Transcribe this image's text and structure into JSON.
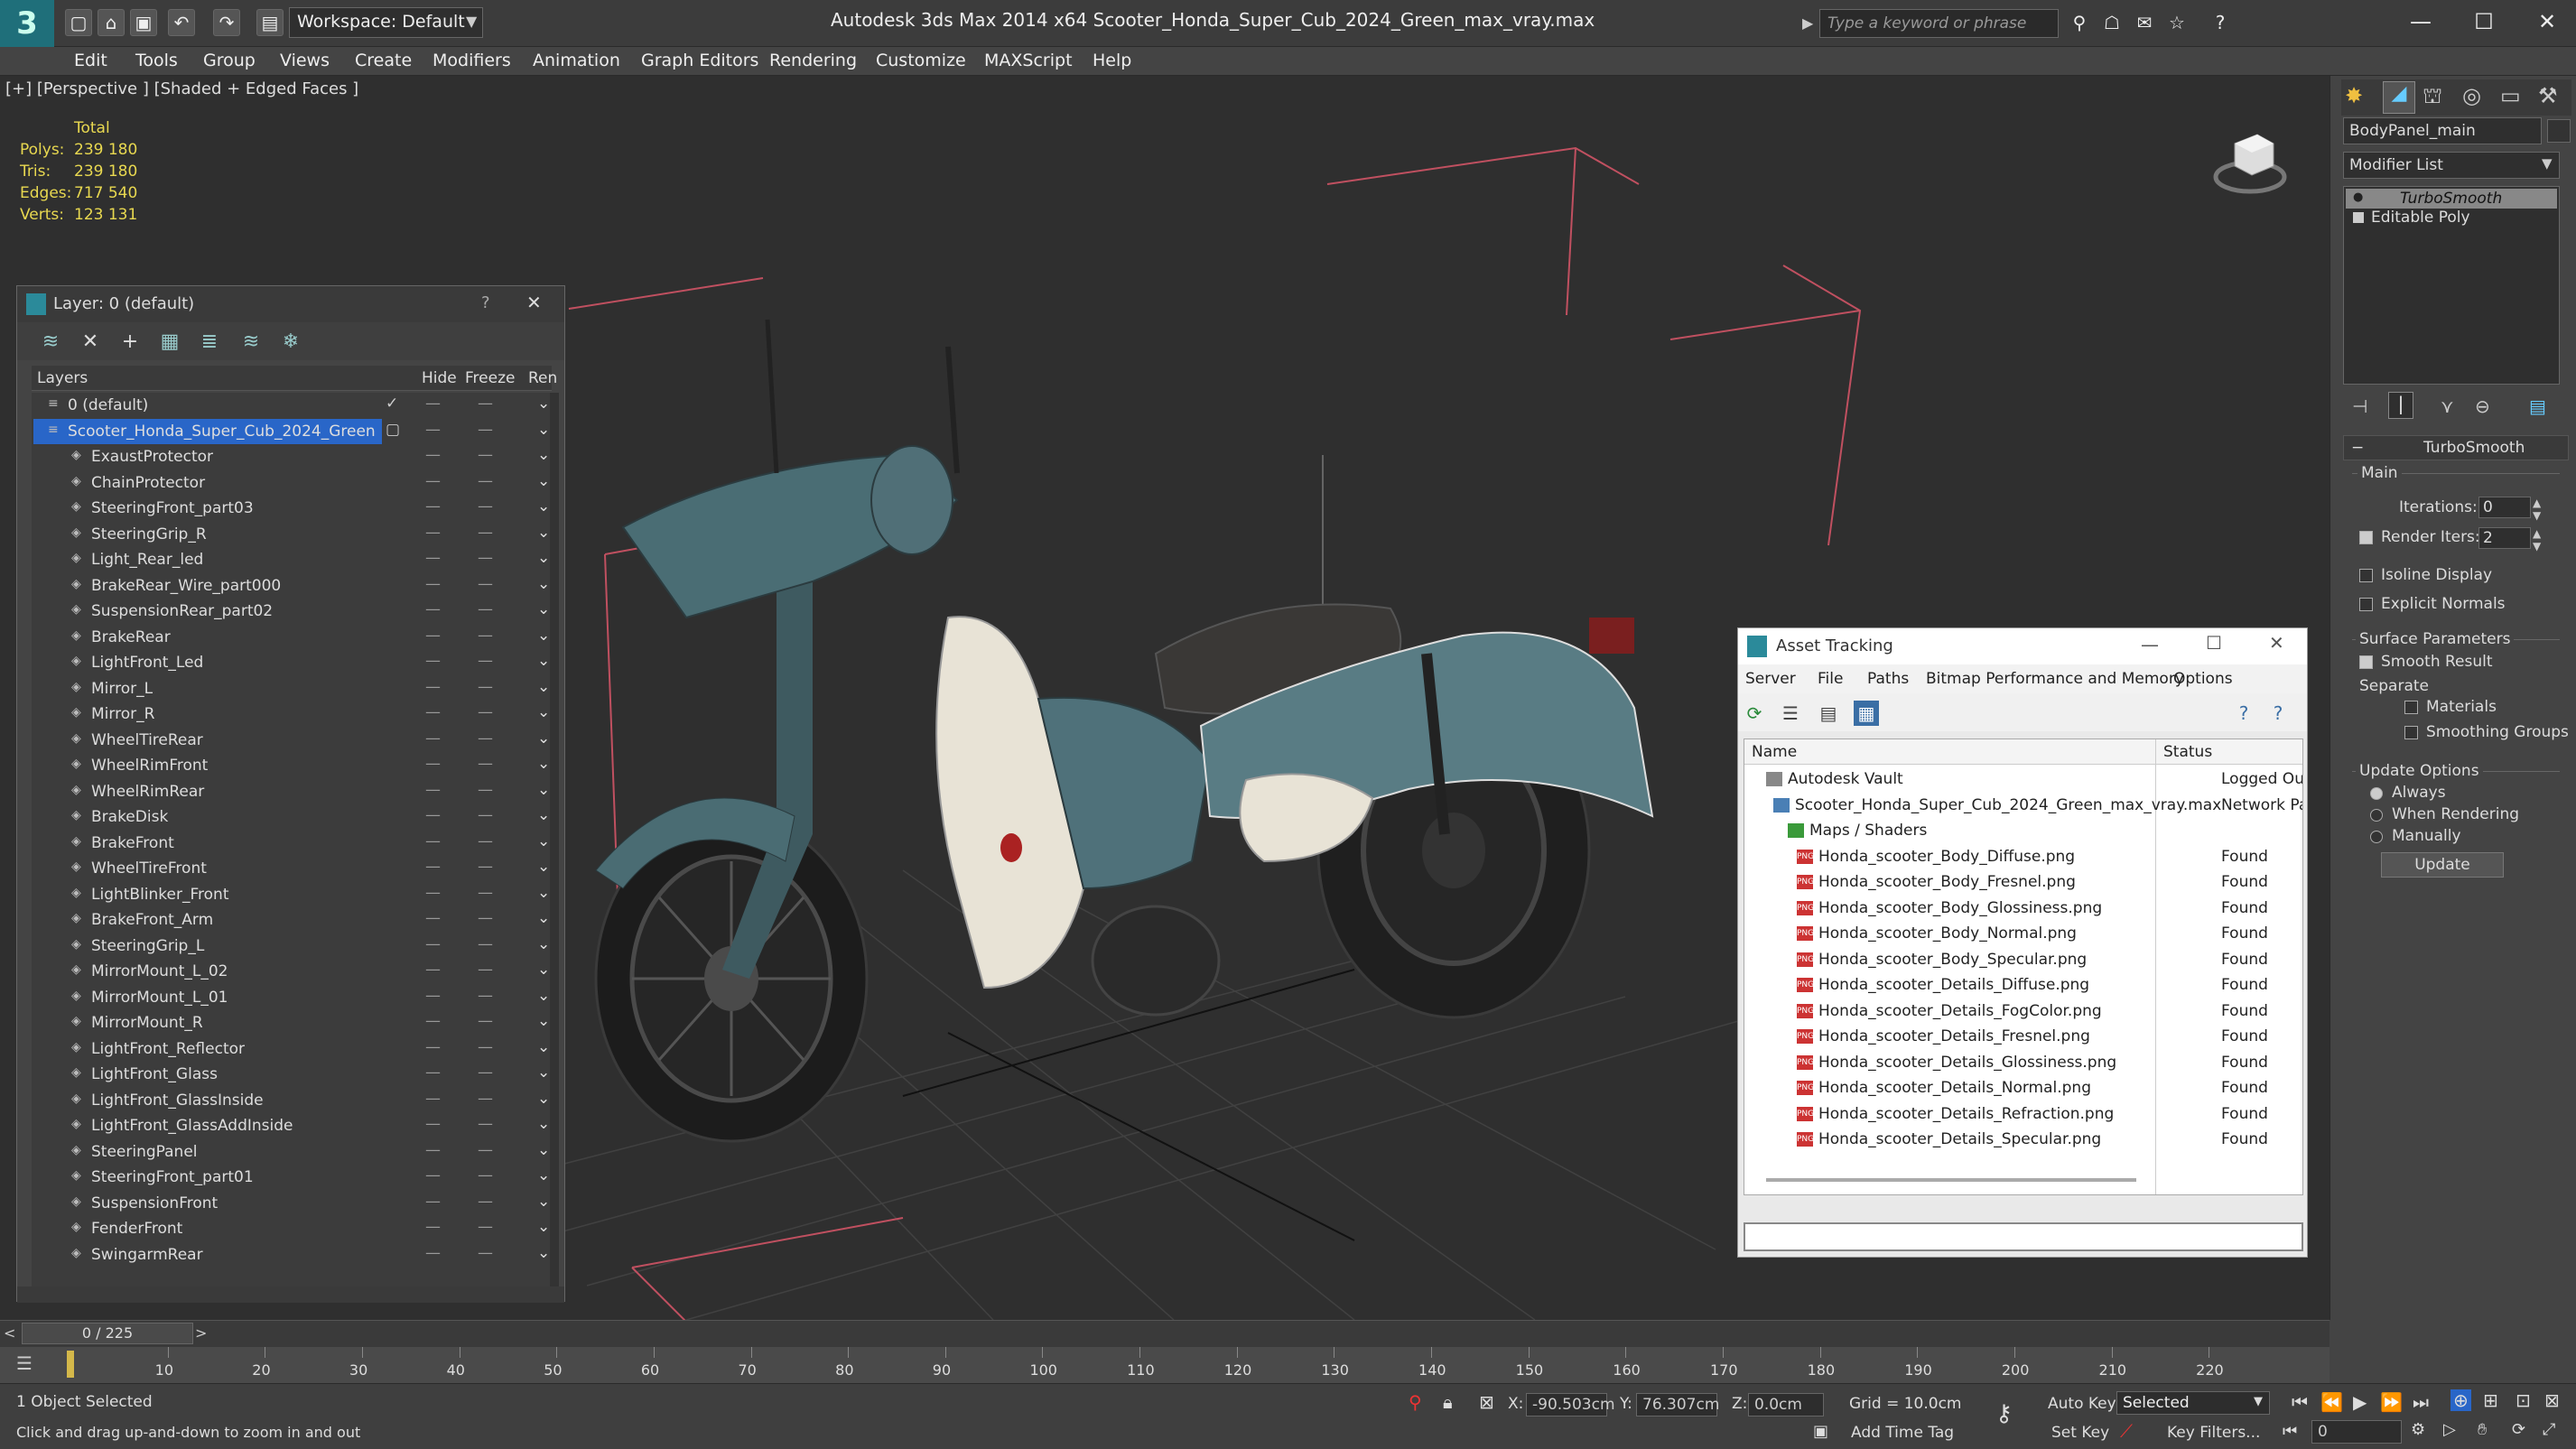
{
  "titlebar": {
    "workspace": "Workspace: Default",
    "title": "Autodesk 3ds Max  2014 x64     Scooter_Honda_Super_Cub_2024_Green_max_vray.max",
    "search_placeholder": "Type a keyword or phrase"
  },
  "menu": [
    "Edit",
    "Tools",
    "Group",
    "Views",
    "Create",
    "Modifiers",
    "Animation",
    "Graph Editors",
    "Rendering",
    "Customize",
    "MAXScript",
    "Help"
  ],
  "viewport": {
    "label": "[+] [Perspective ] [Shaded + Edged Faces ]",
    "stats_header": "Total",
    "stats": [
      {
        "label": "Polys:",
        "value": "239 180"
      },
      {
        "label": "Tris:",
        "value": "239 180"
      },
      {
        "label": "Edges:",
        "value": "717 540"
      },
      {
        "label": "Verts:",
        "value": "123 131"
      }
    ]
  },
  "layer_panel": {
    "title": "Layer: 0 (default)",
    "help": "?",
    "close": "✕",
    "columns": {
      "layers": "Layers",
      "hide": "Hide",
      "freeze": "Freeze",
      "render": "Ren"
    },
    "rows": [
      "0 (default)",
      "Scooter_Honda_Super_Cub_2024_Green",
      "ExaustProtector",
      "ChainProtector",
      "SteeringFront_part03",
      "SteeringGrip_R",
      "Light_Rear_led",
      "BrakeRear_Wire_part000",
      "SuspensionRear_part02",
      "BrakeRear",
      "LightFront_Led",
      "Mirror_L",
      "Mirror_R",
      "WheelTireRear",
      "WheelRimFront",
      "WheelRimRear",
      "BrakeDisk",
      "BrakeFront",
      "WheelTireFront",
      "LightBlinker_Front",
      "BrakeFront_Arm",
      "SteeringGrip_L",
      "MirrorMount_L_02",
      "MirrorMount_L_01",
      "MirrorMount_R",
      "LightFront_Reflector",
      "LightFront_Glass",
      "LightFront_GlassInside",
      "LightFront_GlassAddInside",
      "SteeringPanel",
      "SteeringFront_part01",
      "SuspensionFront",
      "FenderFront",
      "SwingarmRear"
    ]
  },
  "asset_tracking": {
    "title": "Asset Tracking",
    "menu": [
      "Server",
      "File",
      "Paths",
      "Bitmap Performance and Memory",
      "Options"
    ],
    "columns": {
      "name": "Name",
      "status": "Status"
    },
    "rows": [
      {
        "name": "Autodesk Vault",
        "status": "Logged Ou",
        "level": 1
      },
      {
        "name": "Scooter_Honda_Super_Cub_2024_Green_max_vray.max",
        "status": "Network Pa",
        "level": 2
      },
      {
        "name": "Maps / Shaders",
        "status": "",
        "level": 3
      },
      {
        "name": "Honda_scooter_Body_Diffuse.png",
        "status": "Found",
        "level": 4
      },
      {
        "name": "Honda_scooter_Body_Fresnel.png",
        "status": "Found",
        "level": 4
      },
      {
        "name": "Honda_scooter_Body_Glossiness.png",
        "status": "Found",
        "level": 4
      },
      {
        "name": "Honda_scooter_Body_Normal.png",
        "status": "Found",
        "level": 4
      },
      {
        "name": "Honda_scooter_Body_Specular.png",
        "status": "Found",
        "level": 4
      },
      {
        "name": "Honda_scooter_Details_Diffuse.png",
        "status": "Found",
        "level": 4
      },
      {
        "name": "Honda_scooter_Details_FogColor.png",
        "status": "Found",
        "level": 4
      },
      {
        "name": "Honda_scooter_Details_Fresnel.png",
        "status": "Found",
        "level": 4
      },
      {
        "name": "Honda_scooter_Details_Glossiness.png",
        "status": "Found",
        "level": 4
      },
      {
        "name": "Honda_scooter_Details_Normal.png",
        "status": "Found",
        "level": 4
      },
      {
        "name": "Honda_scooter_Details_Refraction.png",
        "status": "Found",
        "level": 4
      },
      {
        "name": "Honda_scooter_Details_Specular.png",
        "status": "Found",
        "level": 4
      }
    ],
    "file_icon_label": "PNG"
  },
  "command_panel": {
    "object_name": "BodyPanel_main",
    "modifier_list": "Modifier List",
    "stack": [
      "TurboSmooth",
      "Editable Poly"
    ],
    "rollout_title": "TurboSmooth",
    "main_label": "Main",
    "iterations_label": "Iterations:",
    "iterations_value": "0",
    "render_iters_label": "Render Iters:",
    "render_iters_value": "2",
    "isoline": "Isoline Display",
    "explicit_normals": "Explicit Normals",
    "surface_params": "Surface Parameters",
    "smooth_result": "Smooth Result",
    "separate": "Separate",
    "materials": "Materials",
    "smoothing_groups": "Smoothing Groups",
    "update_options": "Update Options",
    "always": "Always",
    "when_rendering": "When Rendering",
    "manually": "Manually",
    "update_button": "Update"
  },
  "timeline": {
    "frame": "0 / 225",
    "ticks": [
      "10",
      "20",
      "30",
      "40",
      "50",
      "60",
      "70",
      "80",
      "90",
      "100",
      "110",
      "120",
      "130",
      "140",
      "150",
      "160",
      "170",
      "180",
      "190",
      "200",
      "210",
      "220"
    ]
  },
  "status": {
    "selected": "1 Object Selected",
    "prompt": "Click and drag up-and-down to zoom in and out",
    "x_label": "X:",
    "x_value": "-90.503cm",
    "y_label": "Y:",
    "y_value": "76.307cm",
    "z_label": "Z:",
    "z_value": "0.0cm",
    "grid": "Grid = 10.0cm",
    "auto_key": "Auto Key",
    "set_key": "Set Key",
    "selected_dropdown": "Selected",
    "key_filters": "Key Filters...",
    "add_time_tag": "Add Time Tag",
    "frame_value": "0"
  }
}
